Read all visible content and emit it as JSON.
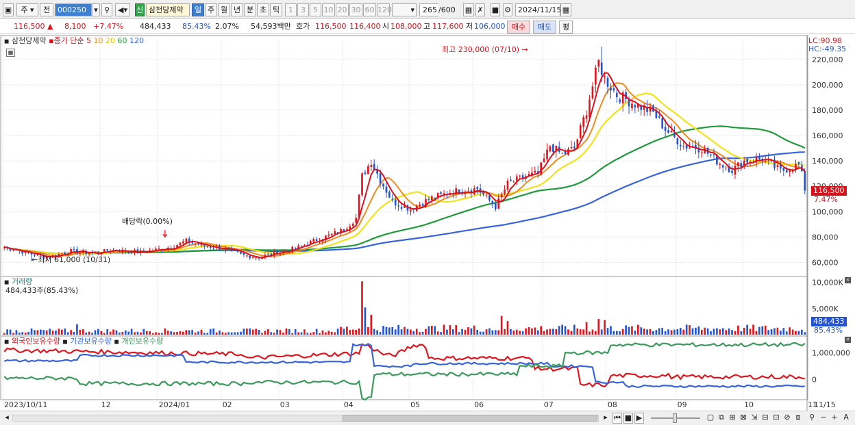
{
  "toolbar": {
    "period_label": "주",
    "prev_label": "전",
    "stock_code": "000250",
    "badge": "신",
    "stock_name": "삼천당제약",
    "timeframes": [
      "일",
      "주",
      "월",
      "년",
      "분",
      "초",
      "틱"
    ],
    "intervals": [
      "1",
      "3",
      "5",
      "10",
      "20",
      "30",
      "60",
      "120"
    ],
    "count_value": "265",
    "count_total": "/600",
    "date": "2024/11/15"
  },
  "quote": {
    "price": "116,500",
    "change": "8,100",
    "change_pct": "+7.47%",
    "volume": "484,433",
    "vol_ratio": "85.43%",
    "turnover": "2.07%",
    "amount": "54,593백만",
    "bid_label": "호가",
    "ask": "116,500",
    "bid": "116,400",
    "open_label": "시",
    "open": "108,000",
    "high_label": "고",
    "high": "117,600",
    "low_label": "저",
    "low": "106,000",
    "buy_button": "매수",
    "sell_button": "매도",
    "eval_button": "평"
  },
  "price_panel": {
    "legend_name": "삼천당제약",
    "legend_close": "종가 단순",
    "ma_labels": [
      "5",
      "10",
      "20",
      "60",
      "120"
    ],
    "lc_label": "LC:90.98",
    "hc_label": "HC:-49.35",
    "high_note": "최고 230,000 (07/10)",
    "low_note": "최저 61,000 (10/31)",
    "dividend_note": "배당락(0.00%)",
    "y_ticks": [
      "220,000",
      "200,000",
      "180,000",
      "160,000",
      "140,000",
      "120,000",
      "100,000",
      "80,000",
      "60,000"
    ],
    "last_price": "116,500",
    "last_pct": "7.47%"
  },
  "volume_panel": {
    "legend": "거래량",
    "value_note": "484,433주(85.43%)",
    "y_ticks": [
      "10,000K",
      "5,000K"
    ],
    "last_value": "484,433",
    "last_pct": "85.43%"
  },
  "holding_panel": {
    "legends": [
      "외국인보유수량",
      "기관보유수량",
      "개인보유수량"
    ],
    "y_ticks": [
      "1,000,000",
      "0"
    ]
  },
  "x_axis": [
    "2023/10/11",
    "12",
    "2024/01",
    "02",
    "03",
    "04",
    "05",
    "06",
    "07",
    "08",
    "09",
    "10",
    "11",
    "11/15"
  ],
  "colors": {
    "up": "#e0161e",
    "down": "#2454d6",
    "ma5": "#d8121b",
    "ma10": "#f08a1c",
    "ma20": "#f2e21a",
    "ma60": "#1f9a3a",
    "ma120": "#3563e0",
    "foreign": "#e0161e",
    "institution": "#3563e0",
    "individual": "#3a9a5a"
  }
}
